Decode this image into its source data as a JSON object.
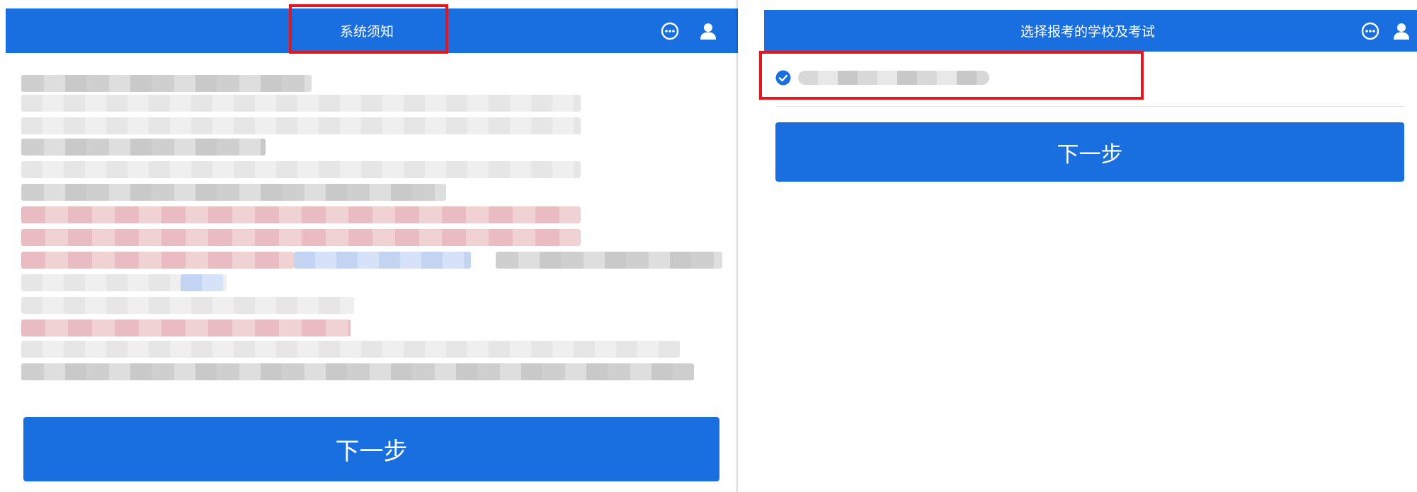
{
  "left": {
    "title": "系统须知",
    "next_label": "下一步",
    "chat_icon": "chat-bubble-icon",
    "user_icon": "user-icon"
  },
  "right": {
    "title": "选择报考的学校及考试",
    "next_label": "下一步",
    "chat_icon": "chat-bubble-icon",
    "user_icon": "user-icon",
    "option_selected": true
  },
  "colors": {
    "primary": "#1a6fe0",
    "highlight": "#e8141c",
    "text_on_primary": "#ffffff"
  }
}
